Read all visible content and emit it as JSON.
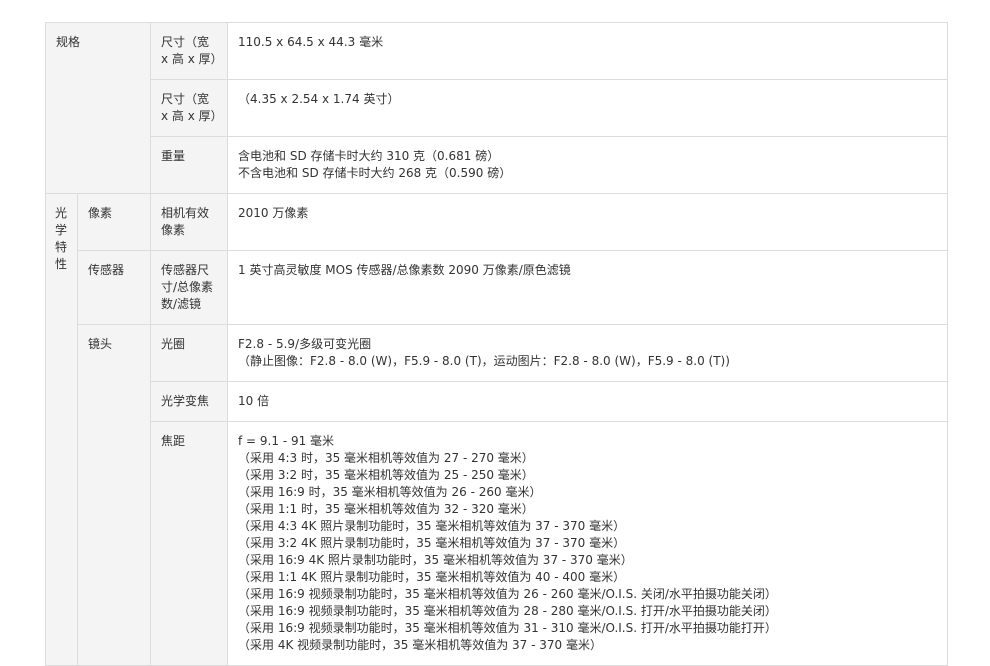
{
  "rows": {
    "spec": {
      "category": "规格",
      "size1": {
        "label": "尺寸（宽 x 高 x 厚）",
        "value": "110.5 x 64.5 x 44.3 毫米"
      },
      "size2": {
        "label": "尺寸（宽 x 高 x 厚）",
        "value": "（4.35 x 2.54 x 1.74 英寸）"
      },
      "weight": {
        "label": "重量",
        "lines": [
          "含电池和 SD 存储卡时大约 310 克（0.681 磅）",
          "不含电池和 SD 存储卡时大约 268 克（0.590 磅）"
        ]
      }
    },
    "optics": {
      "category": "光学特性",
      "category_chars": [
        "光",
        "学",
        "特",
        "性"
      ],
      "pixels": {
        "sub": "像素",
        "label": "相机有效像素",
        "value": "2010 万像素"
      },
      "sensor": {
        "sub": "传感器",
        "label": "传感器尺寸/总像素数/滤镜",
        "value": "1 英寸高灵敏度 MOS 传感器/总像素数 2090 万像素/原色滤镜"
      },
      "lens": {
        "sub": "镜头",
        "aperture": {
          "label": "光圈",
          "lines": [
            "F2.8 - 5.9/多级可变光圈",
            "（静止图像：F2.8 - 8.0 (W)，F5.9 - 8.0 (T)，运动图片：F2.8 - 8.0 (W)，F5.9 - 8.0 (T))"
          ]
        },
        "zoom": {
          "label": "光学变焦",
          "value": "10 倍"
        },
        "focal": {
          "label": "焦距",
          "lines": [
            "f = 9.1 - 91 毫米",
            "（采用 4:3 时，35 毫米相机等效值为 27 - 270 毫米）",
            "（采用 3:2 时，35 毫米相机等效值为 25 - 250 毫米）",
            "（采用 16:9 时，35 毫米相机等效值为 26 - 260 毫米）",
            "（采用 1:1 时，35 毫米相机等效值为 32 - 320 毫米）",
            "（采用 4:3 4K 照片录制功能时，35 毫米相机等效值为 37 - 370 毫米）",
            "（采用 3:2 4K 照片录制功能时，35 毫米相机等效值为 37 - 370 毫米）",
            "（采用 16:9 4K 照片录制功能时，35 毫米相机等效值为 37 - 370 毫米）",
            "（采用 1:1 4K 照片录制功能时，35 毫米相机等效值为 40 - 400 毫米）",
            "（采用 16:9 视频录制功能时，35 毫米相机等效值为 26 - 260 毫米/O.I.S. 关闭/水平拍摄功能关闭）",
            "（采用 16:9 视频录制功能时，35 毫米相机等效值为 28 - 280 毫米/O.I.S. 打开/水平拍摄功能关闭）",
            "（采用 16:9 视频录制功能时，35 毫米相机等效值为 31 - 310 毫米/O.I.S. 打开/水平拍摄功能打开）",
            "（采用 4K 视频录制功能时，35 毫米相机等效值为 37 - 370 毫米）"
          ]
        }
      }
    }
  }
}
